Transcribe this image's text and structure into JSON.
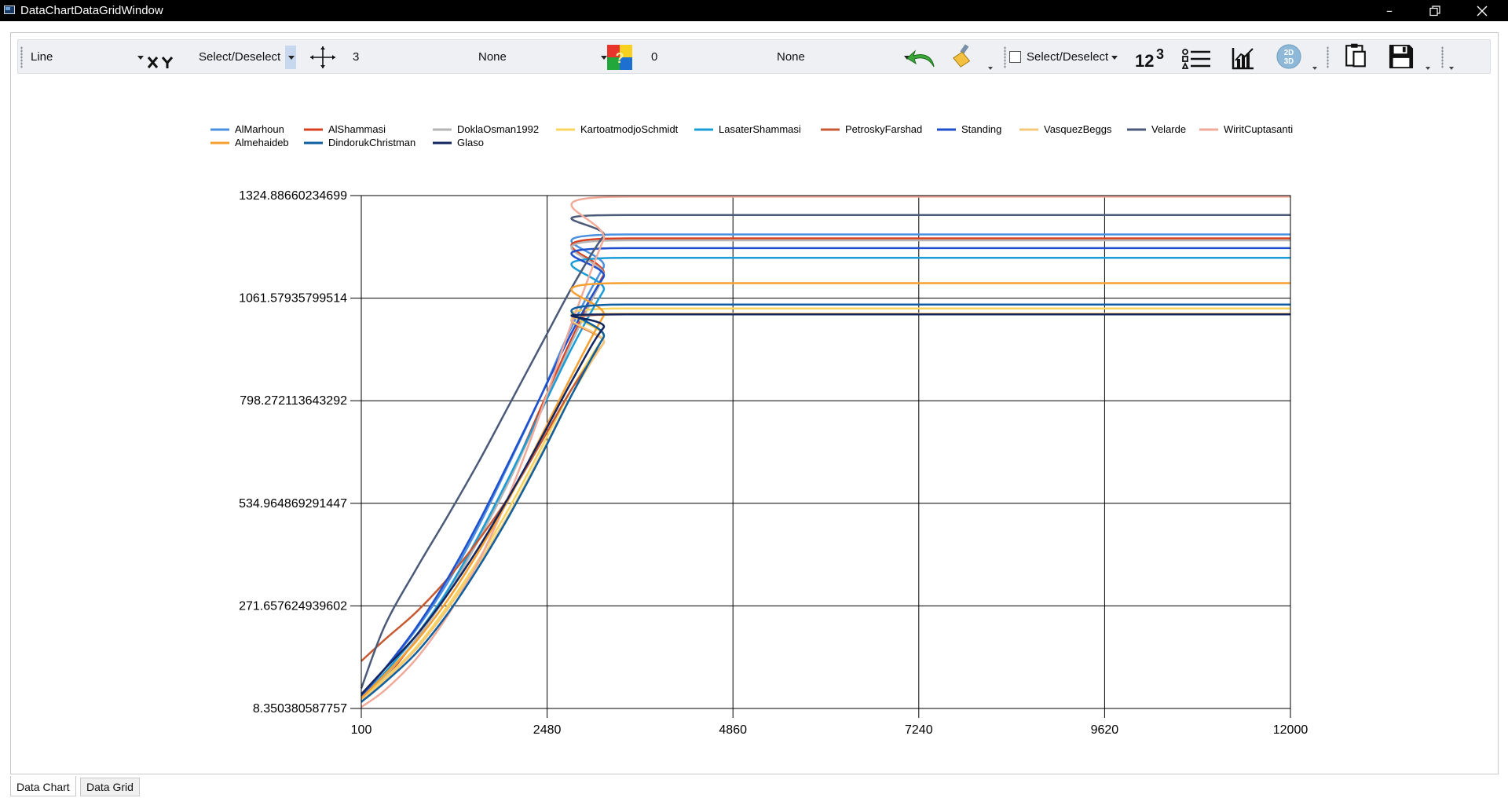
{
  "window": {
    "title": "DataChartDataGridWindow"
  },
  "toolbar": {
    "chart_type": "Line",
    "xy_select": "Select/Deselect",
    "marker_size": "3",
    "marker_style": "None",
    "line_width": "0",
    "line_style": "None",
    "series_select": "Select/Deselect"
  },
  "tabs": [
    {
      "label": "Data Chart"
    },
    {
      "label": "Data Grid"
    }
  ],
  "colors": {
    "titlebar": "#000000",
    "toolbar_bg": "#eef0f4"
  },
  "chart_data": {
    "type": "line",
    "y_ticks": [
      "8.350380587757",
      "271.657624939602",
      "534.964869291447",
      "798.272113643292",
      "1061.57935799514",
      "1324.88660234699"
    ],
    "x_ticks": [
      "100",
      "2480",
      "4860",
      "7240",
      "9620",
      "12000"
    ],
    "xlim": [
      100,
      12000
    ],
    "ylim": [
      8.350380587757,
      1324.88660234699
    ],
    "grid": true,
    "legend_position": "top",
    "x": [
      100,
      400,
      800,
      1200,
      1600,
      2000,
      2400,
      2800,
      3200,
      3500,
      12000
    ],
    "series": [
      {
        "name": "AlMarhoun",
        "color": "#4a8fe0",
        "values": [
          40,
          110,
          210,
          330,
          475,
          640,
          810,
          990,
          1140,
          1225,
          1225
        ]
      },
      {
        "name": "AlShammasi",
        "color": "#d8401f",
        "values": [
          25,
          85,
          185,
          305,
          445,
          600,
          780,
          960,
          1120,
          1215,
          1215
        ]
      },
      {
        "name": "DoklaOsman1992",
        "color": "#b5b5b5",
        "values": [
          30,
          90,
          185,
          300,
          440,
          595,
          770,
          950,
          1115,
          1210,
          1210
        ]
      },
      {
        "name": "KartoatmodjoSchmidt",
        "color": "#f8d45c",
        "values": [
          35,
          85,
          165,
          270,
          390,
          525,
          675,
          830,
          960,
          1035,
          1035
        ]
      },
      {
        "name": "LasaterShammasi",
        "color": "#1a9cd8",
        "values": [
          35,
          100,
          195,
          310,
          450,
          605,
          770,
          935,
          1080,
          1165,
          1165
        ]
      },
      {
        "name": "PetroskyFarshad",
        "color": "#c85a33",
        "values": [
          130,
          185,
          255,
          340,
          440,
          555,
          690,
          830,
          945,
          1020,
          1020
        ]
      },
      {
        "name": "Standing",
        "color": "#1f4fcc",
        "values": [
          40,
          110,
          215,
          340,
          485,
          645,
          810,
          975,
          1115,
          1190,
          1190
        ]
      },
      {
        "name": "VasquezBeggs",
        "color": "#f4c87a",
        "values": [
          30,
          80,
          160,
          262,
          380,
          510,
          660,
          815,
          945,
          1022,
          1022
        ]
      },
      {
        "name": "Velarde",
        "color": "#4a5a78",
        "values": [
          60,
          220,
          365,
          500,
          640,
          790,
          940,
          1090,
          1220,
          1275,
          1275
        ]
      },
      {
        "name": "WiritCuptasanti",
        "color": "#f0aa9a",
        "values": [
          12,
          55,
          135,
          245,
          385,
          560,
          770,
          1000,
          1210,
          1322,
          1322
        ]
      },
      {
        "name": "Almehaideb",
        "color": "#f5a030",
        "values": [
          35,
          95,
          180,
          285,
          410,
          550,
          705,
          865,
          1015,
          1100,
          1100
        ]
      },
      {
        "name": "DindorukChristman",
        "color": "#0e5fa0",
        "values": [
          25,
          75,
          150,
          250,
          370,
          505,
          655,
          815,
          960,
          1045,
          1045
        ]
      },
      {
        "name": "Glaso",
        "color": "#13255e",
        "values": [
          45,
          110,
          195,
          300,
          420,
          555,
          700,
          850,
          985,
          1020,
          1020
        ]
      }
    ]
  }
}
